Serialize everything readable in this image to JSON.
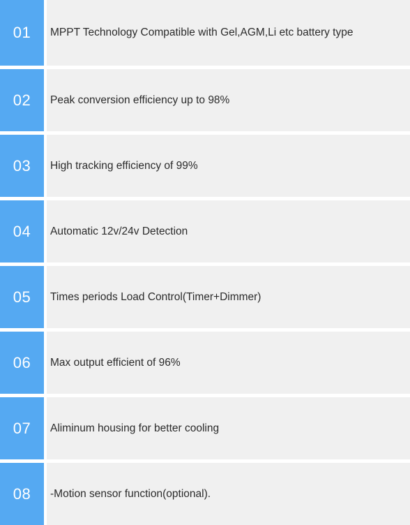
{
  "theme": {
    "accent_blue": "#55a9f2",
    "panel_gray": "#f0f0f0",
    "text_color": "#2b2b2b",
    "index_text_color": "#ffffff",
    "page_background": "#ffffff"
  },
  "feature_list": {
    "items": [
      {
        "index": "01",
        "text": "MPPT Technology Compatible with Gel,AGM,Li etc battery type",
        "lines": 2
      },
      {
        "index": "02",
        "text": "Peak conversion efficiency up to 98%",
        "lines": 1
      },
      {
        "index": "03",
        "text": "High tracking efficiency of 99%",
        "lines": 1
      },
      {
        "index": "04",
        "text": "Automatic 12v/24v Detection",
        "lines": 1
      },
      {
        "index": "05",
        "text": "Times periods Load Control(Timer+Dimmer)",
        "lines": 1
      },
      {
        "index": "06",
        "text": "Max output efficient of 96%",
        "lines": 1
      },
      {
        "index": "07",
        "text": "Aliminum housing for better cooling",
        "lines": 1
      },
      {
        "index": "08",
        "text": "-Motion sensor function(optional).",
        "lines": 1
      }
    ]
  }
}
